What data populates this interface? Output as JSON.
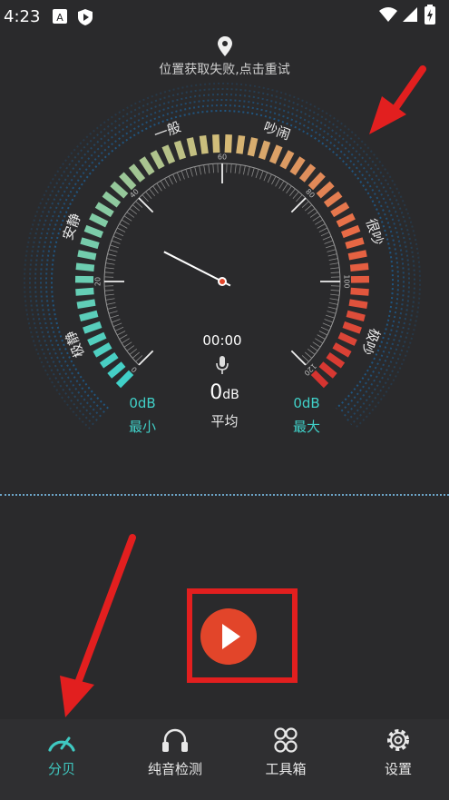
{
  "status_bar": {
    "time": "4:23"
  },
  "location": {
    "message": "位置获取失败,点击重试"
  },
  "gauge": {
    "level_labels": [
      "极静",
      "安静",
      "一般",
      "吵闹",
      "很吵",
      "极吵"
    ],
    "scale_ticks": [
      "0",
      "20",
      "40",
      "60",
      "80",
      "100",
      "120"
    ],
    "scale_max": 120,
    "needle_value": 32
  },
  "readout": {
    "timer": "00:00",
    "min_value": "0dB",
    "min_label": "最小",
    "avg_number": "0",
    "avg_unit": "dB",
    "avg_label": "平均",
    "max_value": "0dB",
    "max_label": "最大"
  },
  "nav": {
    "items": [
      {
        "label": "分贝",
        "icon": "speedometer-icon",
        "active": true
      },
      {
        "label": "纯音检测",
        "icon": "headphones-icon",
        "active": false
      },
      {
        "label": "工具箱",
        "icon": "clover-grid-icon",
        "active": false
      },
      {
        "label": "设置",
        "icon": "settings-gear-icon",
        "active": false
      }
    ]
  },
  "colors": {
    "accent": "#40d0c8",
    "danger": "#e21f1f",
    "play": "#e2452a"
  }
}
